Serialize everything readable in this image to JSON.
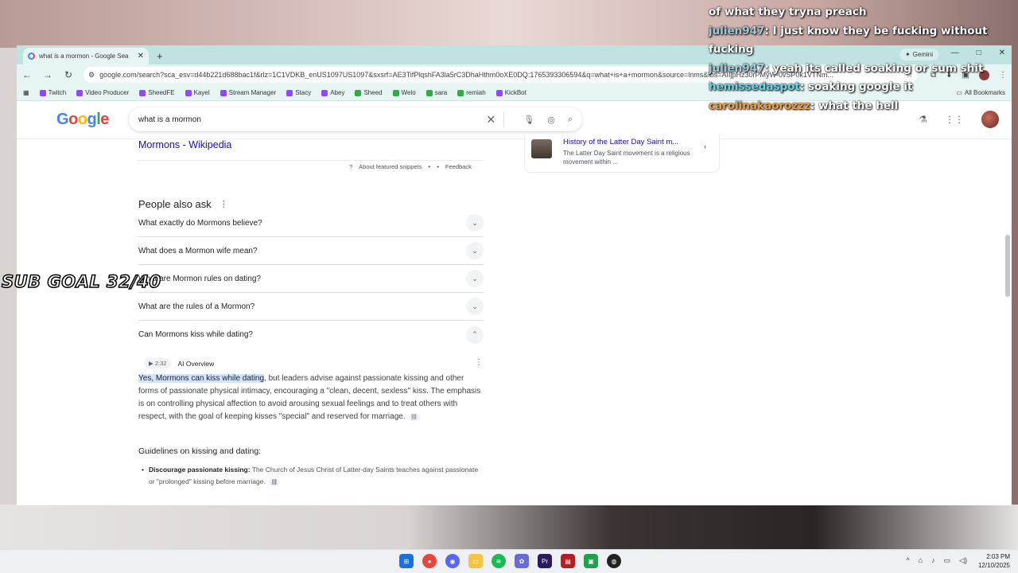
{
  "tab": {
    "title": "what is a mormon - Google Sea",
    "close": "✕",
    "new": "+"
  },
  "gemini": {
    "label": "Gemini"
  },
  "window": {
    "min": "—",
    "max": "□",
    "close": "✕"
  },
  "url": "google.com/search?sca_esv=d44b221d688bac1f&rlz=1C1VDKB_enUS1097US1097&sxsrf=AE3TifPlqshFA3la5rC3DhaHthm0oXE0DQ:1765393306594&q=what+is+a+mormon&source=lnms&fbs=AIIjpHz30rPMyW-0vSP0k1VTNm...",
  "bookmarks": [
    {
      "label": "Twitch",
      "color": "#9146ff"
    },
    {
      "label": "Video Producer",
      "color": "#9146ff"
    },
    {
      "label": "SheedFE",
      "color": "#9146ff"
    },
    {
      "label": "Kayel",
      "color": "#9146ff"
    },
    {
      "label": "Stream Manager",
      "color": "#9146ff"
    },
    {
      "label": "Stacy",
      "color": "#9146ff"
    },
    {
      "label": "Abey",
      "color": "#9146ff"
    },
    {
      "label": "Sheed",
      "color": "#2eae3f"
    },
    {
      "label": "Welo",
      "color": "#2eae3f"
    },
    {
      "label": "sara",
      "color": "#2eae3f"
    },
    {
      "label": "remiah",
      "color": "#2eae3f"
    },
    {
      "label": "KickBot",
      "color": "#9146ff"
    }
  ],
  "all_bookmarks": "All Bookmarks",
  "search": {
    "query": "what is a mormon"
  },
  "logo": [
    "G",
    "o",
    "o",
    "g",
    "l",
    "e"
  ],
  "wiki": {
    "title": "Mormons - Wikipedia"
  },
  "snippet_links": {
    "about": "About featured snippets",
    "sep": "•",
    "feedback": "Feedback"
  },
  "side_card": {
    "title": "History of the Latter Day Saint m...",
    "desc": "The Latter Day Saint movement is a religious movement within ..."
  },
  "paa": {
    "heading": "People also ask",
    "questions": [
      "What exactly do Mormons believe?",
      "What does a Mormon wife mean?",
      "What are Mormon rules on dating?",
      "What are the rules of a Mormon?",
      "Can Mormons kiss while dating?"
    ]
  },
  "ai": {
    "play": "▶ 2:32",
    "label": "AI Overview"
  },
  "answer": {
    "highlight": "Yes, Mormons can kiss while dating",
    "rest": ", but leaders advise against passionate kissing and other forms of passionate physical intimacy, encouraging a \"clean, decent, sexless\" kiss. The emphasis is on controlling physical affection to avoid arousing sexual feelings and to treat others with respect, with the goal of keeping kisses \"special\" and reserved for marriage."
  },
  "guidelines": {
    "heading": "Guidelines on kissing and dating:",
    "bullet_bold": "Discourage passionate kissing:",
    "bullet_text": " The Church of Jesus Christ of Latter-day Saints teaches against passionate or \"prolonged\" kissing before marriage."
  },
  "chat": {
    "line1": "of what they tryna preach",
    "user1": "julien947",
    "msg1": ": I just know they be fucking without fucking",
    "user2": "julien947",
    "msg2": ": yeah its called soaking or sum shit",
    "user3": "hemissedaspot",
    "msg3": ": soaking google it",
    "user4": "carolinakaorozzz",
    "msg4": ": what the hell"
  },
  "overlay": {
    "subgoal": "SUB GOAL 32/40"
  },
  "clock": {
    "time": "2:03 PM",
    "date": "12/10/2025"
  }
}
